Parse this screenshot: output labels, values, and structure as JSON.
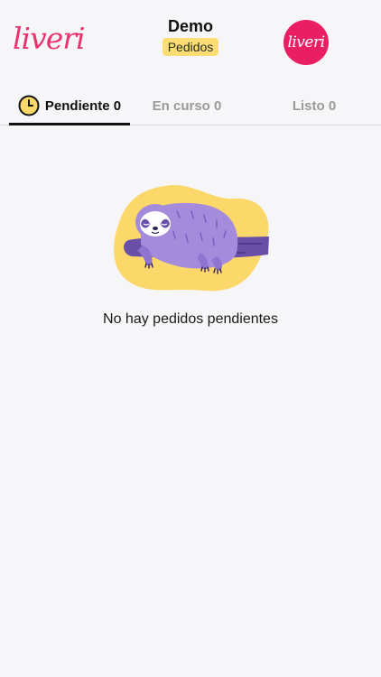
{
  "header": {
    "logo_left": "liveri",
    "title": "Demo",
    "badge": "Pedidos",
    "logo_right": "liveri"
  },
  "tabs": [
    {
      "label": "Pendiente 0",
      "active": true,
      "icon": "clock-icon"
    },
    {
      "label": "En curso 0",
      "active": false
    },
    {
      "label": "Listo 0",
      "active": false
    }
  ],
  "empty_state": {
    "illustration": "sleeping-sloth",
    "message": "No hay pedidos pendientes"
  },
  "colors": {
    "brand_pink": "#e8336d",
    "badge_yellow": "#fbdd74",
    "sloth_purple": "#a48bdc",
    "blob_yellow": "#fcd86a"
  }
}
